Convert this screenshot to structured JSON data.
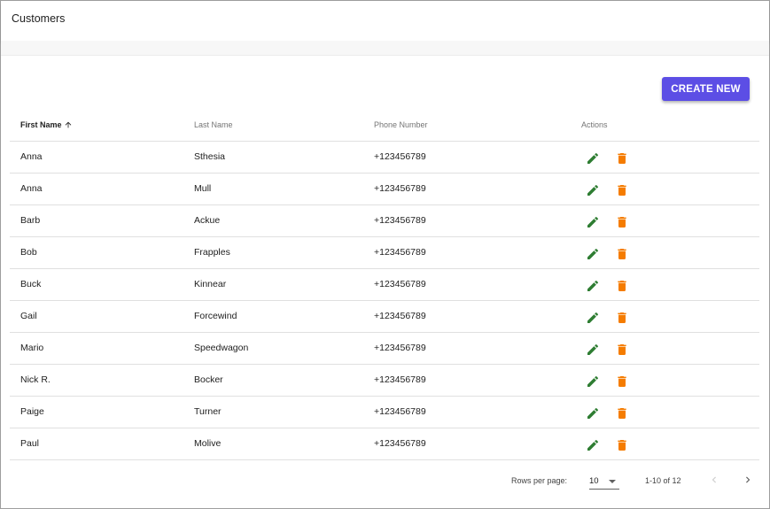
{
  "header": {
    "title": "Customers"
  },
  "toolbar": {
    "create_label": "CREATE NEW"
  },
  "table": {
    "columns": [
      "First Name",
      "Last Name",
      "Phone Number",
      "Actions"
    ],
    "sort": {
      "column": "First Name",
      "direction": "ascending"
    },
    "rows": [
      {
        "first": "Anna",
        "last": "Sthesia",
        "phone": "+123456789"
      },
      {
        "first": "Anna",
        "last": "Mull",
        "phone": "+123456789"
      },
      {
        "first": "Barb",
        "last": "Ackue",
        "phone": "+123456789"
      },
      {
        "first": "Bob",
        "last": "Frapples",
        "phone": "+123456789"
      },
      {
        "first": "Buck",
        "last": "Kinnear",
        "phone": "+123456789"
      },
      {
        "first": "Gail",
        "last": "Forcewind",
        "phone": "+123456789"
      },
      {
        "first": "Mario",
        "last": "Speedwagon",
        "phone": "+123456789"
      },
      {
        "first": "Nick R.",
        "last": "Bocker",
        "phone": "+123456789"
      },
      {
        "first": "Paige",
        "last": "Turner",
        "phone": "+123456789"
      },
      {
        "first": "Paul",
        "last": "Molive",
        "phone": "+123456789"
      }
    ],
    "row_actions": [
      {
        "icon": "pencil-icon",
        "color": "#2e7d32"
      },
      {
        "icon": "trash-icon",
        "color": "#f57c00"
      }
    ]
  },
  "pagination": {
    "rows_per_page_label": "Rows per page:",
    "rows_per_page_value": "10",
    "range_text": "1-10 of 12",
    "prev_icon": "chevron-left-icon",
    "next_icon": "chevron-right-icon"
  },
  "colors": {
    "accent": "#5c4ee5",
    "edit": "#2e7d32",
    "delete": "#f57c00"
  }
}
